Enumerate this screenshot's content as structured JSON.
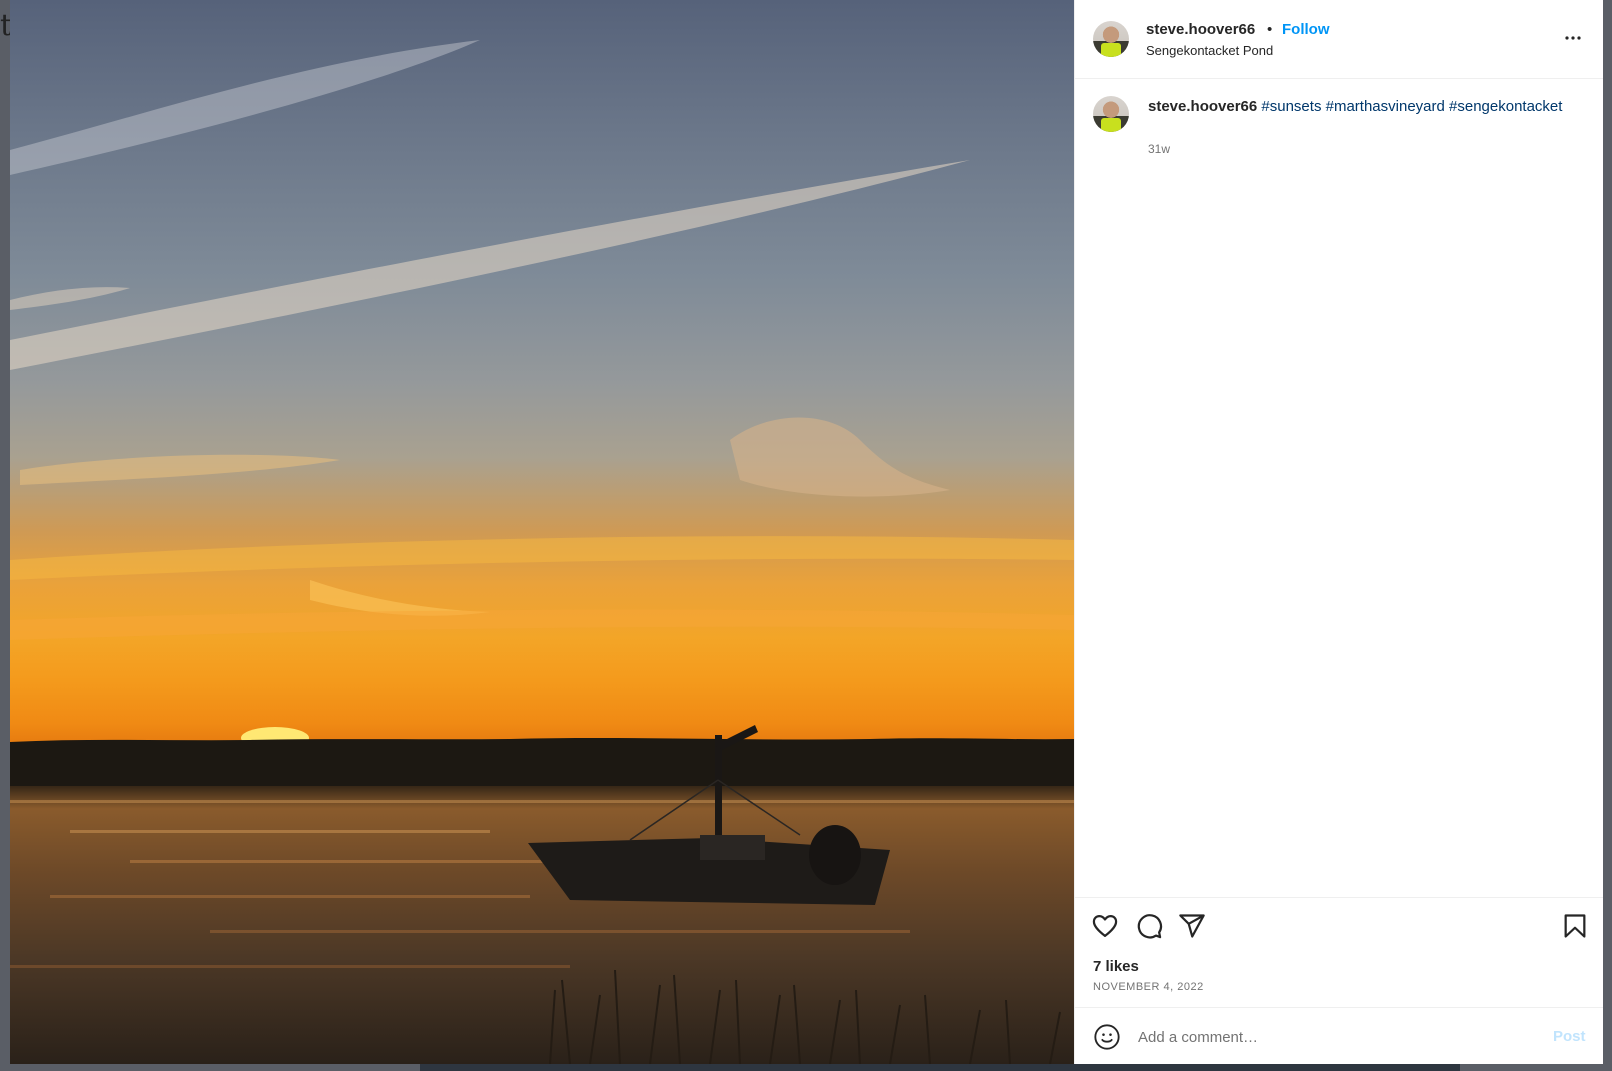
{
  "backdrop": {
    "partial_letter": "t"
  },
  "post": {
    "author": {
      "username": "steve.hoover66",
      "avatar_icon": "avatar-photo-icon"
    },
    "header": {
      "separator": "•",
      "follow_label": "Follow",
      "location": "Sengekontacket Pond",
      "more_icon": "more-options-icon"
    },
    "caption": {
      "username": "steve.hoover66",
      "hashtags": [
        "#sunsets",
        "#marthasvineyard",
        "#sengekontacket"
      ],
      "age": "31w"
    },
    "actions": {
      "like_icon": "heart-icon",
      "comment_icon": "comment-icon",
      "share_icon": "share-icon",
      "save_icon": "bookmark-icon"
    },
    "likes": "7 likes",
    "date": "NOVEMBER 4, 2022",
    "comment_box": {
      "emoji_icon": "emoji-icon",
      "placeholder": "Add a comment…",
      "post_label": "Post"
    },
    "media": {
      "description_icon": "sunset-photo"
    }
  },
  "colors": {
    "link_blue": "#0095f6",
    "hashtag_blue": "#00376b",
    "post_disabled": "#c1e4fd",
    "text_primary": "#262626",
    "text_secondary": "#737373"
  }
}
